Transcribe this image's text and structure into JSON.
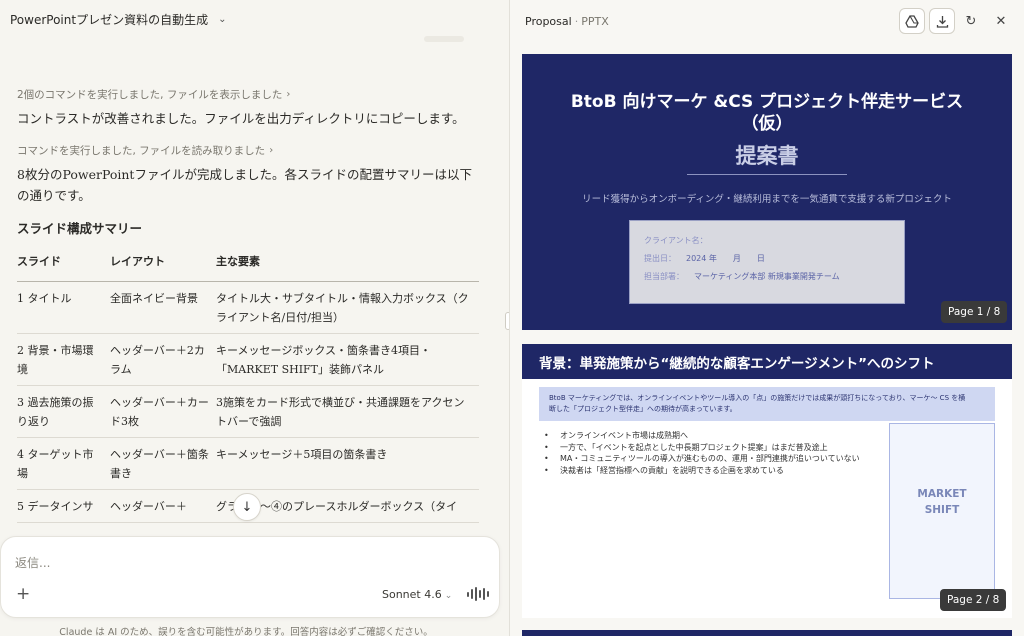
{
  "chat": {
    "title": "PowerPointプレゼン資料の自動生成",
    "messages": {
      "cmd1": "2個のコマンドを実行しました, ファイルを表示しました",
      "text1": "コントラストが改善されました。ファイルを出力ディレクトリにコピーします。",
      "cmd2": "コマンドを実行しました, ファイルを読み取りました",
      "text2": "8枚分のPowerPointファイルが完成しました。各スライドの配置サマリーは以下の通りです。",
      "heading": "スライド構成サマリー"
    },
    "table": {
      "headers": [
        "スライド",
        "レイアウト",
        "主な要素"
      ],
      "rows": [
        [
          "1 タイトル",
          "全面ネイビー背景",
          "タイトル大・サブタイトル・情報入力ボックス（クライアント名/日付/担当）"
        ],
        [
          "2 背景・市場環境",
          "ヘッダーバー＋2カラム",
          "キーメッセージボックス・箇条書き4項目・「MARKET SHIFT」装飾パネル"
        ],
        [
          "3 過去施策の振り返り",
          "ヘッダーバー＋カード3枚",
          "3施策をカード形式で横並び・共通課題をアクセントバーで強調"
        ],
        [
          "4 ターゲット市場",
          "ヘッダーバー＋箇条書き",
          "キーメッセージ＋5項目の箇条書き"
        ],
        [
          "5 データインサ",
          "ヘッダーバー＋",
          "グラフ①〜④のプレースホルダーボックス（タイ"
        ]
      ]
    },
    "composer": {
      "placeholder": "返信...",
      "model": "Sonnet 4.6"
    },
    "disclaimer": "Claude は AI のため、誤りを含む可能性があります。回答内容は必ずご確認ください。"
  },
  "preview": {
    "file_name": "Proposal",
    "file_type": "PPTX",
    "slide1": {
      "title_line1": "BtoB 向けマーケ &CS プロジェクト伴走サービス",
      "title_line2": "（仮）",
      "subtitle": "提案書",
      "lead": "リード獲得からオンボーディング・継続利用までを一気通貫で支援する新プロジェクト",
      "info_client_label": "クライアント名：",
      "info_date_label": "提出日：",
      "info_date_value": "2024 年　　月　　日",
      "info_owner_label": "担当部署：",
      "info_owner_value": "マーケティング本部 新規事業開発チーム",
      "page": "Page 1 / 8"
    },
    "slide2": {
      "header": "背景：単発施策から“継続的な顧客エンゲージメント”へのシフト",
      "message_line1": "BtoB マーケティングでは、オンラインイベントやツール導入の「点」の施策だけでは成果が頭打ちになっており、マーケ〜 CS を横",
      "message_line2": "断した「プロジェクト型伴走」への期待が高まっています。",
      "bullets": [
        "オンラインイベント市場は成熟期へ",
        "一方で、「イベントを起点とした中長期プロジェクト提案」はまだ普及途上",
        "MA・コミュニティツールの導入が進むものの、運用・部門連携が追いついていない",
        "決裁者は「経営指標への貢献」を説明できる企画を求めている"
      ],
      "panel_line1": "MARKET",
      "panel_line2": "SHIFT",
      "page": "Page 2 / 8"
    }
  }
}
